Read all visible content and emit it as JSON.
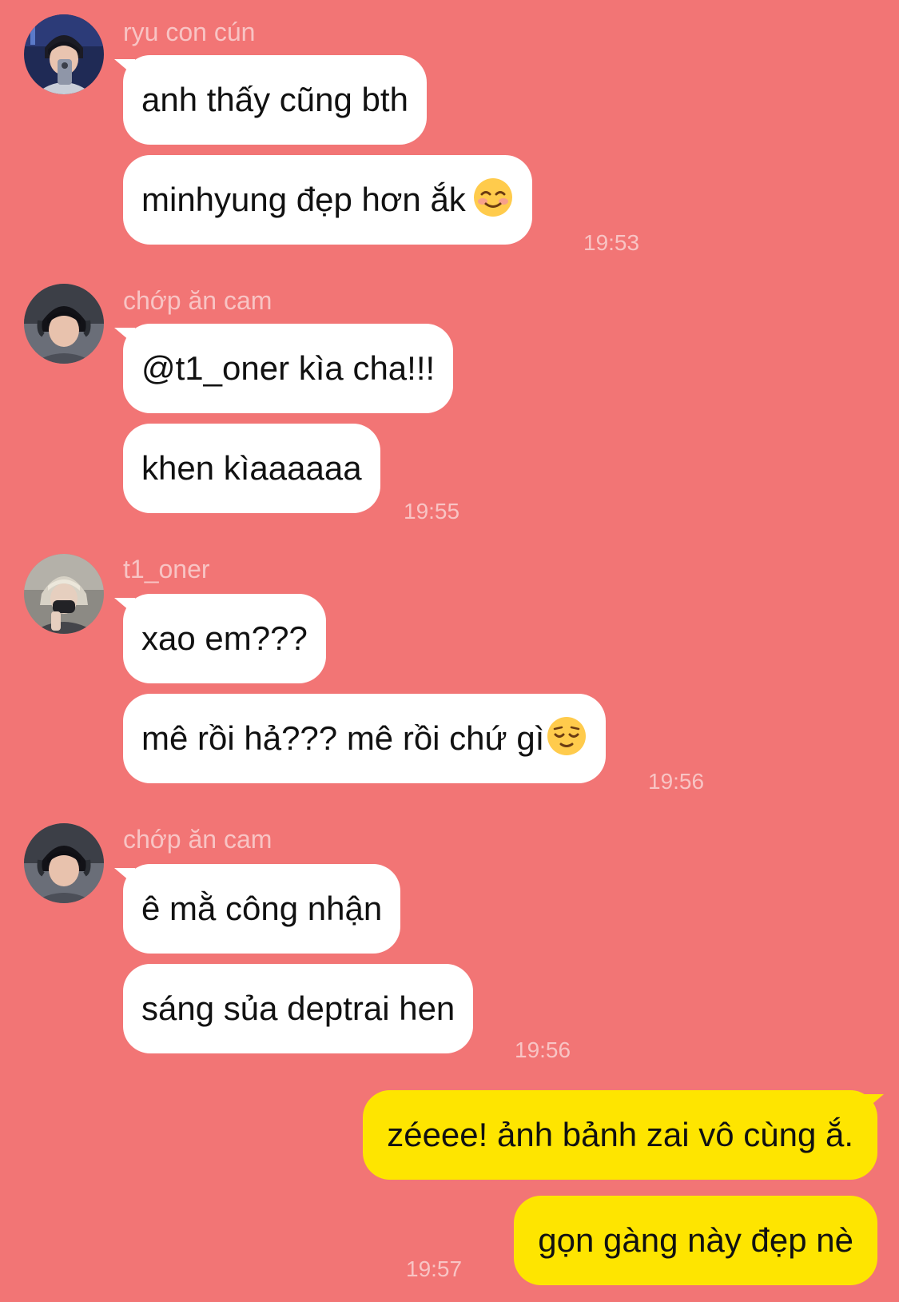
{
  "messages": [
    {
      "sender": "ryu con cún",
      "lines": [
        "anh thấy cũng bth",
        "minhyung đẹp hơn ắk"
      ],
      "time": "19:53"
    },
    {
      "sender": "chớp ăn cam",
      "lines": [
        "@t1_oner kìa cha!!!",
        "khen kìaaaaaa"
      ],
      "time": "19:55"
    },
    {
      "sender": "t1_oner",
      "lines": [
        "xao em???",
        "mê rồi hả??? mê rồi chứ gì"
      ],
      "time": "19:56"
    },
    {
      "sender": "chớp ăn cam",
      "lines": [
        "ê mằ công nhận",
        "sáng sủa deptrai hen"
      ],
      "time": "19:56"
    },
    {
      "sender": "me",
      "lines": [
        "zéeee! ảnh bảnh zai vô cùng ắ.",
        "gọn gàng này đẹp nè"
      ],
      "time": "19:57"
    }
  ],
  "icons": {
    "smiling-blush-emoji": "smiling-face-with-smiling-eyes-emoji",
    "relieved-emoji": "relieved-face-emoji"
  },
  "colors": {
    "background": "#f27575",
    "incoming_bubble": "#ffffff",
    "outgoing_bubble": "#fee500",
    "meta_text": "#f8c4c4"
  }
}
